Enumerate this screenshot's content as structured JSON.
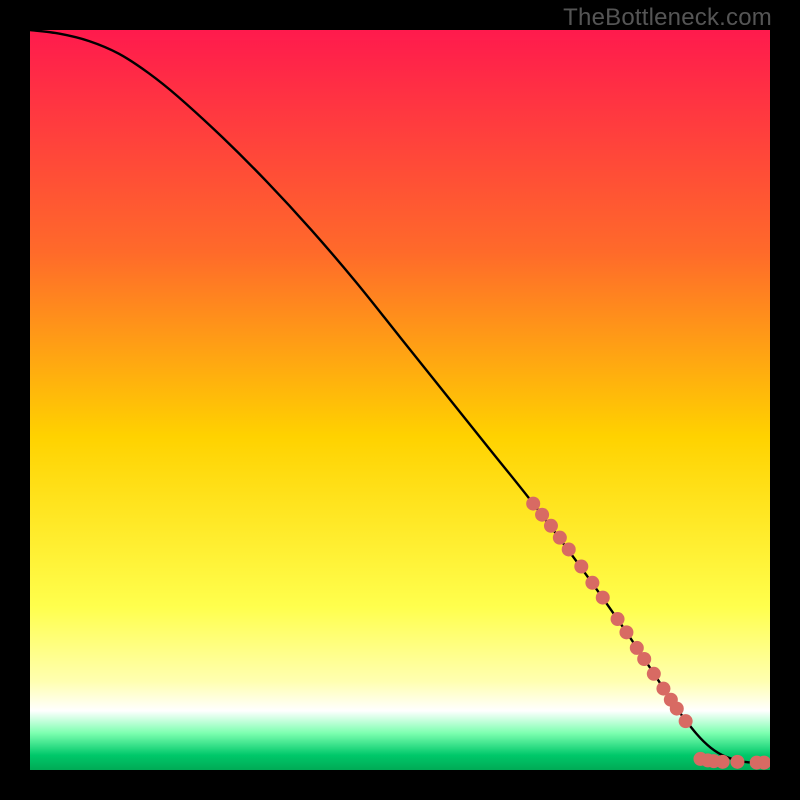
{
  "watermark": "TheBottleneck.com",
  "colors": {
    "curve": "#000000",
    "marker_fill": "#d86a63",
    "marker_stroke": "#b84f49",
    "frame": "#000000"
  },
  "chart_data": {
    "type": "line",
    "title": "",
    "xlabel": "",
    "ylabel": "",
    "xlim": [
      0,
      100
    ],
    "ylim": [
      0,
      100
    ],
    "grid": false,
    "legend": false,
    "gradient_stops": [
      {
        "offset": 0,
        "color": "#ff1a4d"
      },
      {
        "offset": 30,
        "color": "#ff6a2a"
      },
      {
        "offset": 55,
        "color": "#ffd200"
      },
      {
        "offset": 78,
        "color": "#ffff4d"
      },
      {
        "offset": 88,
        "color": "#ffffb0"
      },
      {
        "offset": 92,
        "color": "#ffffff"
      },
      {
        "offset": 95,
        "color": "#7dffb0"
      },
      {
        "offset": 98,
        "color": "#00c86a"
      },
      {
        "offset": 100,
        "color": "#00aa55"
      }
    ],
    "series": [
      {
        "name": "curve",
        "x": [
          0,
          4,
          8,
          12,
          16,
          20,
          26,
          32,
          38,
          44,
          50,
          56,
          62,
          68,
          74,
          80,
          84,
          88,
          92,
          96,
          100
        ],
        "y": [
          100,
          99.5,
          98.5,
          96.8,
          94.2,
          91,
          85.5,
          79.5,
          73,
          66,
          58.5,
          51,
          43.5,
          36,
          28,
          19.5,
          13.5,
          7.5,
          3.0,
          1.2,
          1.0
        ]
      }
    ],
    "markers": [
      {
        "x": 68.0,
        "y": 36.0
      },
      {
        "x": 69.2,
        "y": 34.5
      },
      {
        "x": 70.4,
        "y": 33.0
      },
      {
        "x": 71.6,
        "y": 31.4
      },
      {
        "x": 72.8,
        "y": 29.8
      },
      {
        "x": 74.5,
        "y": 27.5
      },
      {
        "x": 76.0,
        "y": 25.3
      },
      {
        "x": 77.4,
        "y": 23.3
      },
      {
        "x": 79.4,
        "y": 20.4
      },
      {
        "x": 80.6,
        "y": 18.6
      },
      {
        "x": 82.0,
        "y": 16.5
      },
      {
        "x": 83.0,
        "y": 15.0
      },
      {
        "x": 84.3,
        "y": 13.0
      },
      {
        "x": 85.6,
        "y": 11.0
      },
      {
        "x": 86.6,
        "y": 9.5
      },
      {
        "x": 87.4,
        "y": 8.3
      },
      {
        "x": 88.6,
        "y": 6.6
      },
      {
        "x": 90.6,
        "y": 1.5
      },
      {
        "x": 91.6,
        "y": 1.3
      },
      {
        "x": 92.4,
        "y": 1.2
      },
      {
        "x": 93.6,
        "y": 1.1
      },
      {
        "x": 95.6,
        "y": 1.1
      },
      {
        "x": 98.2,
        "y": 1.0
      },
      {
        "x": 99.2,
        "y": 1.0
      }
    ],
    "marker_radius_px": 7
  }
}
